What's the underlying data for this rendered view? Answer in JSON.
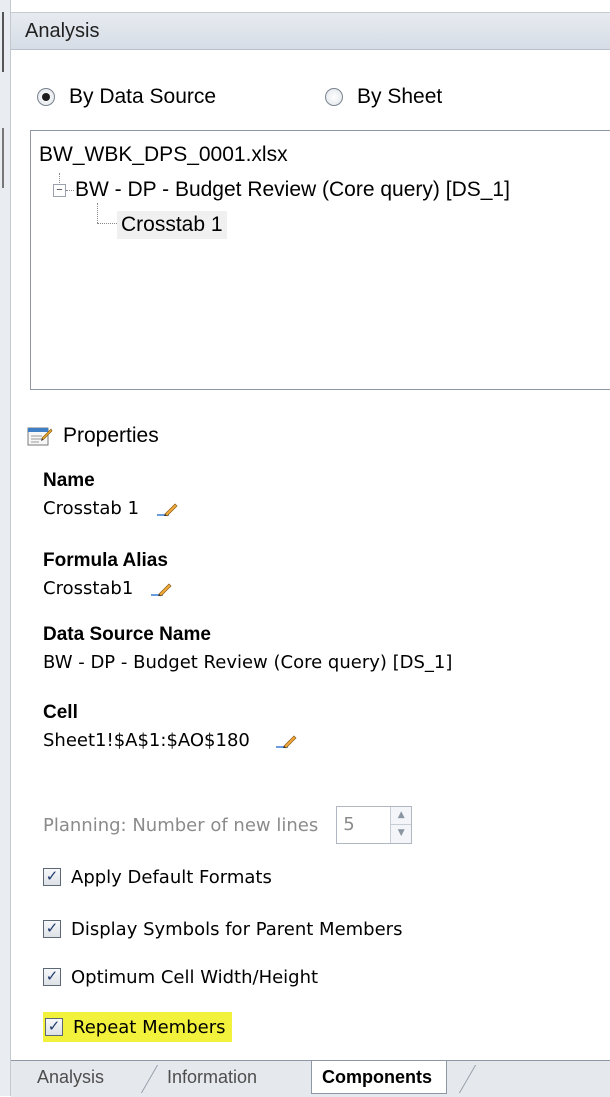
{
  "panel": {
    "title": "Analysis"
  },
  "view_mode": {
    "options": [
      {
        "label": "By Data Source",
        "selected": true
      },
      {
        "label": "By Sheet",
        "selected": false
      }
    ]
  },
  "tree": {
    "file": "BW_WBK_DPS_0001.xlsx",
    "query": "BW - DP - Budget Review (Core query) [DS_1]",
    "component": "Crosstab 1"
  },
  "properties": {
    "header": "Properties",
    "name_label": "Name",
    "name_value": "Crosstab 1",
    "alias_label": "Formula Alias",
    "alias_value": "Crosstab1",
    "ds_label": "Data Source Name",
    "ds_value": "BW - DP - Budget Review (Core query) [DS_1]",
    "cell_label": "Cell",
    "cell_value": "Sheet1!$A$1:$AO$180",
    "planning_label": "Planning: Number of new lines",
    "planning_value": "5",
    "checkboxes": [
      {
        "label": "Apply Default Formats",
        "checked": true
      },
      {
        "label": "Display Symbols for Parent Members",
        "checked": true
      },
      {
        "label": "Optimum Cell Width/Height",
        "checked": true
      },
      {
        "label": "Repeat Members",
        "checked": true
      }
    ]
  },
  "tabs": [
    {
      "label": "Analysis",
      "active": false
    },
    {
      "label": "Information",
      "active": false
    },
    {
      "label": "Components",
      "active": true
    }
  ],
  "colors": {
    "highlight": "#f2f23d",
    "title_bar": "#dde3ea"
  }
}
